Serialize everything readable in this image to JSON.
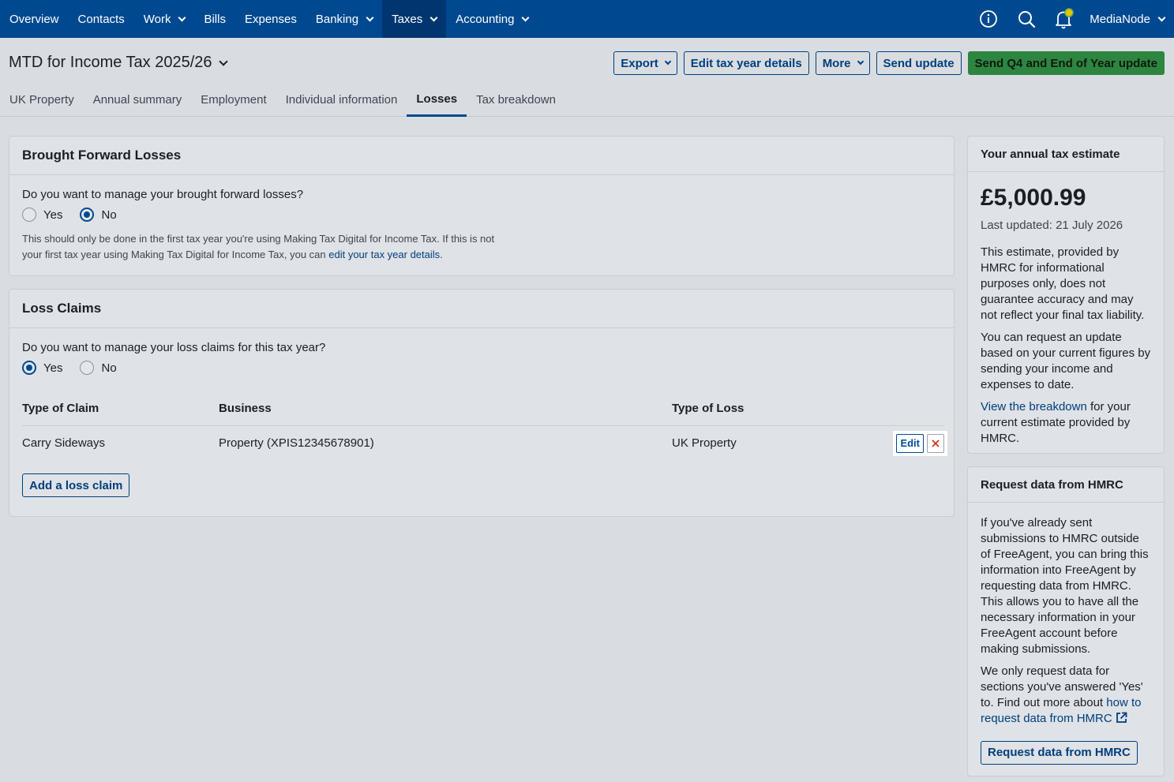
{
  "nav": {
    "items": [
      {
        "label": "Overview",
        "dropdown": false
      },
      {
        "label": "Contacts",
        "dropdown": false
      },
      {
        "label": "Work",
        "dropdown": true
      },
      {
        "label": "Bills",
        "dropdown": false
      },
      {
        "label": "Expenses",
        "dropdown": false
      },
      {
        "label": "Banking",
        "dropdown": true
      },
      {
        "label": "Taxes",
        "dropdown": true,
        "active": true
      },
      {
        "label": "Accounting",
        "dropdown": true
      }
    ],
    "icons": [
      "info-icon",
      "search-icon",
      "bell-icon"
    ],
    "user": "MediaNode"
  },
  "header": {
    "title": "MTD for Income Tax 2025/26",
    "actions": {
      "export": "Export",
      "edit_tax_year": "Edit tax year details",
      "more": "More",
      "send_update": "Send update",
      "send_q4": "Send Q4 and End of Year update"
    },
    "tabs": [
      "UK Property",
      "Annual summary",
      "Employment",
      "Individual information",
      "Losses",
      "Tax breakdown"
    ],
    "active_tab": "Losses"
  },
  "brought_forward": {
    "title": "Brought Forward Losses",
    "question": "Do you want to manage your brought forward losses?",
    "options": {
      "yes": "Yes",
      "no": "No"
    },
    "selected": "No",
    "hint_line1": "This should only be done in the first tax year you're using Making Tax Digital for Income Tax. If this is not",
    "hint_line2": "your first tax year using Making Tax Digital for Income Tax, you can ",
    "hint_link": "edit your tax year details",
    "hint_end": "."
  },
  "loss_claims": {
    "title": "Loss Claims",
    "question": "Do you want to manage your loss claims for this tax year?",
    "options": {
      "yes": "Yes",
      "no": "No"
    },
    "selected": "Yes",
    "columns": {
      "type_of_claim": "Type of Claim",
      "business": "Business",
      "type_of_loss": "Type of Loss"
    },
    "rows": [
      {
        "type_of_claim": "Carry Sideways",
        "business": "Property (XPIS12345678901)",
        "type_of_loss": "UK Property",
        "edit_label": "Edit"
      }
    ],
    "add_button": "Add a loss claim"
  },
  "estimate": {
    "title": "Your annual tax estimate",
    "amount": "£5,000.99",
    "updated": "Last updated: 21 July 2026",
    "para1": "This estimate, provided by HMRC for informational purposes only, does not guarantee accuracy and may not reflect your final tax liability.",
    "para2": "You can request an update based on your current figures by sending your income and expenses to date.",
    "para3_link": "View the breakdown",
    "para3_rest": " for your current estimate provided by HMRC."
  },
  "request": {
    "title": "Request data from HMRC",
    "para1": "If you've already sent submissions to HMRC outside of FreeAgent, you can bring this information into FreeAgent by requesting data from HMRC. This allows you to have all the necessary information in your FreeAgent account before making submissions.",
    "para2_start": "We only request data for sections you've answered 'Yes' to. Find out more about ",
    "para2_link": "how to request data from HMRC",
    "button": "Request data from HMRC"
  },
  "colors": {
    "nav_bg": "#004990",
    "link": "#003f7d",
    "primary_green": "#2e8540",
    "danger_red": "#d4351c"
  }
}
